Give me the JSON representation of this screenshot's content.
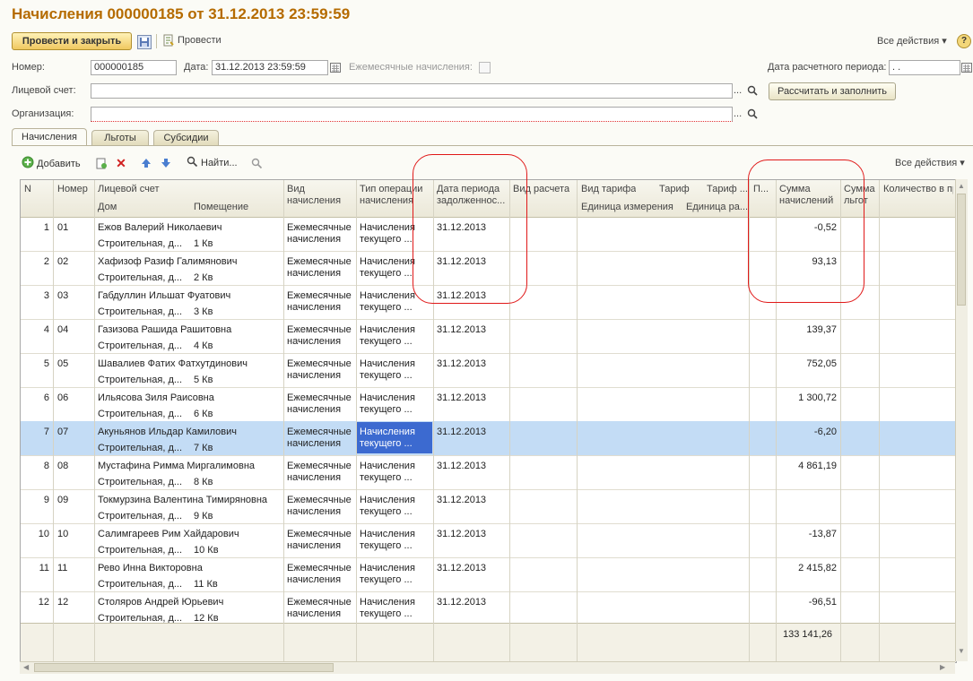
{
  "title": "Начисления 000000185 от 31.12.2013 23:59:59",
  "toolbar": {
    "post_close": "Провести и закрыть",
    "post": "Провести",
    "all_actions": "Все действия",
    "help": "?"
  },
  "form": {
    "number_label": "Номер:",
    "number": "000000185",
    "date_label": "Дата:",
    "date": "31.12.2013 23:59:59",
    "monthly_label": "Ежемесячные начисления:",
    "period_label": "Дата расчетного периода:",
    "period": " .  .",
    "account_label": "Лицевой счет:",
    "account": "",
    "org_label": "Организация:",
    "org": "",
    "calc_button": "Рассчитать и заполнить",
    "ellipsis": "..."
  },
  "tabs": [
    "Начисления",
    "Льготы",
    "Субсидии"
  ],
  "grid_toolbar": {
    "add": "Добавить",
    "find": "Найти...",
    "all_actions": "Все действия"
  },
  "columns": {
    "n": "N",
    "num": "Номер",
    "account": "Лицевой счет",
    "house": "Дом",
    "room": "Помещение",
    "kind1": "Вид",
    "kind2": "начисления",
    "op1": "Тип операции",
    "op2": "начисления",
    "debt1": "Дата периода",
    "debt2": "задолженнос...",
    "calc": "Вид расчета",
    "tariff_kind": "Вид тарифа",
    "unit": "Единица измерения",
    "tariff": "Тариф",
    "tariff2": "Тариф ...",
    "unit2": "Единица ра...",
    "p": "П...",
    "sum1": "Сумма",
    "sum2": "начислений",
    "priv1": "Сумма",
    "priv2": "льгот",
    "qty": "Количество в пр..."
  },
  "rows": [
    {
      "n": "1",
      "num": "01",
      "name": "Ежов Валерий Николаевич",
      "house": "Строительная, д...",
      "room": "1 Кв",
      "kind1": "Ежемесячные",
      "kind2": "начисления",
      "op1": "Начисления",
      "op2": "текущего ...",
      "date": "31.12.2013",
      "sum": "-0,52"
    },
    {
      "n": "2",
      "num": "02",
      "name": "Хафизоф Разиф Галимянович",
      "house": "Строительная, д...",
      "room": "2 Кв",
      "kind1": "Ежемесячные",
      "kind2": "начисления",
      "op1": "Начисления",
      "op2": "текущего ...",
      "date": "31.12.2013",
      "sum": "93,13"
    },
    {
      "n": "3",
      "num": "03",
      "name": "Габдуллин Ильшат Фуатович",
      "house": "Строительная, д...",
      "room": "3 Кв",
      "kind1": "Ежемесячные",
      "kind2": "начисления",
      "op1": "Начисления",
      "op2": "текущего ...",
      "date": "31.12.2013",
      "sum": ""
    },
    {
      "n": "4",
      "num": "04",
      "name": "Газизова Рашида Рашитовна",
      "house": "Строительная, д...",
      "room": "4 Кв",
      "kind1": "Ежемесячные",
      "kind2": "начисления",
      "op1": "Начисления",
      "op2": "текущего ...",
      "date": "31.12.2013",
      "sum": "139,37"
    },
    {
      "n": "5",
      "num": "05",
      "name": "Шавалиев Фатих Фатхутдинович",
      "house": "Строительная, д...",
      "room": "5 Кв",
      "kind1": "Ежемесячные",
      "kind2": "начисления",
      "op1": "Начисления",
      "op2": "текущего ...",
      "date": "31.12.2013",
      "sum": "752,05"
    },
    {
      "n": "6",
      "num": "06",
      "name": "Ильясова Зиля Раисовна",
      "house": "Строительная, д...",
      "room": "6 Кв",
      "kind1": "Ежемесячные",
      "kind2": "начисления",
      "op1": "Начисления",
      "op2": "текущего ...",
      "date": "31.12.2013",
      "sum": "1 300,72"
    },
    {
      "n": "7",
      "num": "07",
      "name": "Акуньянов Ильдар Камилович",
      "house": "Строительная, д...",
      "room": "7 Кв",
      "kind1": "Ежемесячные",
      "kind2": "начисления",
      "op1": "Начисления",
      "op2": "текущего ...",
      "date": "31.12.2013",
      "sum": "-6,20"
    },
    {
      "n": "8",
      "num": "08",
      "name": "Мустафина Римма Миргалимовна",
      "house": "Строительная, д...",
      "room": "8 Кв",
      "kind1": "Ежемесячные",
      "kind2": "начисления",
      "op1": "Начисления",
      "op2": "текущего ...",
      "date": "31.12.2013",
      "sum": "4 861,19"
    },
    {
      "n": "9",
      "num": "09",
      "name": "Токмурзина Валентина Тимиряновна",
      "house": "Строительная, д...",
      "room": "9 Кв",
      "kind1": "Ежемесячные",
      "kind2": "начисления",
      "op1": "Начисления",
      "op2": "текущего ...",
      "date": "31.12.2013",
      "sum": ""
    },
    {
      "n": "10",
      "num": "10",
      "name": "Салимгареев Рим Хайдарович",
      "house": "Строительная, д...",
      "room": "10 Кв",
      "kind1": "Ежемесячные",
      "kind2": "начисления",
      "op1": "Начисления",
      "op2": "текущего ...",
      "date": "31.12.2013",
      "sum": "-13,87"
    },
    {
      "n": "11",
      "num": "11",
      "name": "Рево Инна Викторовна",
      "house": "Строительная, д...",
      "room": "11 Кв",
      "kind1": "Ежемесячные",
      "kind2": "начисления",
      "op1": "Начисления",
      "op2": "текущего ...",
      "date": "31.12.2013",
      "sum": "2 415,82"
    },
    {
      "n": "12",
      "num": "12",
      "name": "Столяров Андрей Юрьевич",
      "house": "Строительная, д...",
      "room": "12 Кв",
      "kind1": "Ежемесячные",
      "kind2": "начисления",
      "op1": "Начисления",
      "op2": "текущего ...",
      "date": "31.12.2013",
      "sum": "-96,51"
    }
  ],
  "selected_row": 7,
  "total_sum": "133 141,26",
  "colors": {
    "title": "#b56b00",
    "selection": "#c3dcf5",
    "annotation": "#e01818"
  }
}
